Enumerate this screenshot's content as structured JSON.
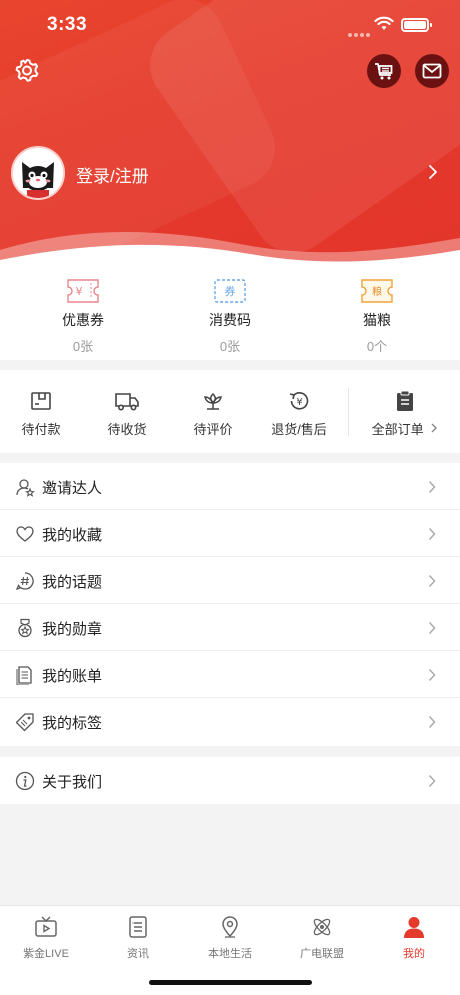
{
  "status_bar": {
    "time": "3:33"
  },
  "header": {
    "login_label": "登录/注册",
    "accent": "#e53a2c"
  },
  "assets": [
    {
      "name": "优惠券",
      "count": "0张",
      "icon": "coupon-icon",
      "color": "#e8868c",
      "glyph": "¥"
    },
    {
      "name": "消费码",
      "count": "0张",
      "icon": "ticket-icon",
      "color": "#66a7e6",
      "glyph": "券"
    },
    {
      "name": "猫粮",
      "count": "0个",
      "icon": "cat-food-icon",
      "color": "#f0a43a",
      "glyph": "粮"
    }
  ],
  "orders": [
    {
      "name": "待付款",
      "icon": "wallet-icon"
    },
    {
      "name": "待收货",
      "icon": "truck-icon"
    },
    {
      "name": "待评价",
      "icon": "flower-icon"
    },
    {
      "name": "退货/售后",
      "icon": "refund-icon",
      "glyph": "¥"
    }
  ],
  "all_orders": {
    "label": "全部订单",
    "icon": "clipboard-icon"
  },
  "menu": [
    {
      "label": "邀请达人",
      "icon": "invite-user-icon"
    },
    {
      "label": "我的收藏",
      "icon": "heart-icon"
    },
    {
      "label": "我的话题",
      "icon": "hashtag-icon"
    },
    {
      "label": "我的勋章",
      "icon": "medal-icon"
    },
    {
      "label": "我的账单",
      "icon": "bill-icon"
    },
    {
      "label": "我的标签",
      "icon": "tag-icon"
    }
  ],
  "about": {
    "label": "关于我们",
    "icon": "info-icon"
  },
  "tabs": [
    {
      "name": "紫金LIVE",
      "icon": "live-tv-icon"
    },
    {
      "name": "资讯",
      "icon": "news-icon"
    },
    {
      "name": "本地生活",
      "icon": "location-icon"
    },
    {
      "name": "广电联盟",
      "icon": "atom-icon"
    },
    {
      "name": "我的",
      "icon": "person-icon",
      "active": true
    }
  ]
}
